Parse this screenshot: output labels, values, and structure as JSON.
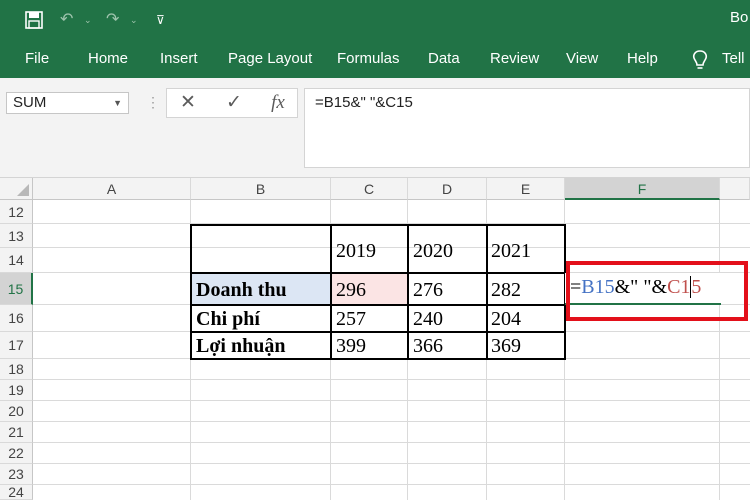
{
  "title_bar": {
    "doc_title": "Bo"
  },
  "ribbon": {
    "tabs": [
      "File",
      "Home",
      "Insert",
      "Page Layout",
      "Formulas",
      "Data",
      "Review",
      "View",
      "Help",
      "Tell"
    ]
  },
  "formula_bar": {
    "name_box": "SUM",
    "formula": "=B15&\" \"&C15"
  },
  "sheet": {
    "columns": [
      "A",
      "B",
      "C",
      "D",
      "E",
      "F"
    ],
    "active_column": "F",
    "rows": [
      "12",
      "13",
      "14",
      "15",
      "16",
      "17",
      "18",
      "19",
      "20",
      "21",
      "22",
      "23",
      "24"
    ],
    "active_row": "15",
    "table": {
      "years": [
        "2019",
        "2020",
        "2021"
      ],
      "rows": [
        {
          "label": "Doanh thu",
          "values": [
            "296",
            "276",
            "282"
          ]
        },
        {
          "label": "Chi phí",
          "values": [
            "257",
            "240",
            "204"
          ]
        },
        {
          "label": "Lợi nhuận",
          "values": [
            "399",
            "366",
            "369"
          ]
        }
      ]
    },
    "editing_cell": {
      "prefix": "=",
      "ref1": "B15",
      "middle": "&\" \"&",
      "ref2_a": "C1",
      "ref2_b": "5"
    }
  },
  "colors": {
    "ribbon": "#217346",
    "ref_blue": "#4472c4",
    "ref_red": "#c0504d",
    "callout": "#e3101a"
  }
}
